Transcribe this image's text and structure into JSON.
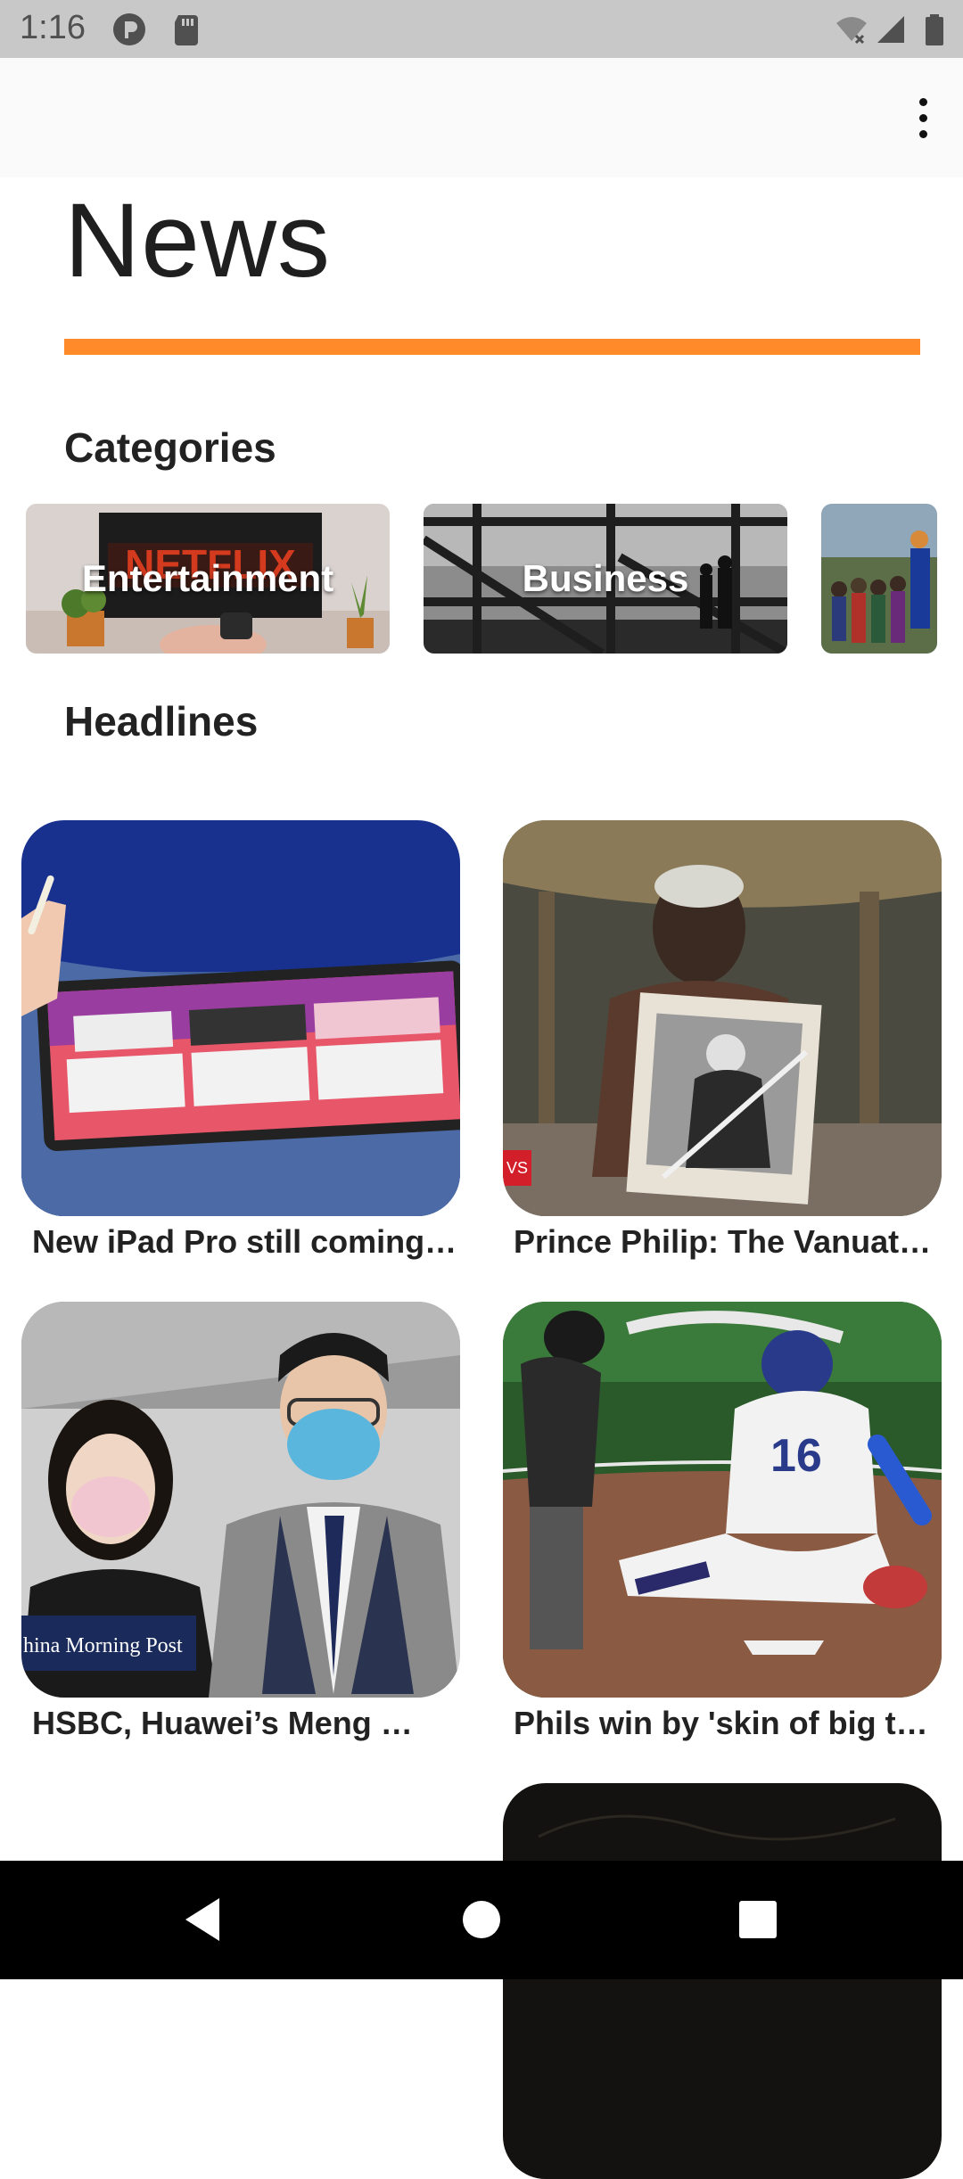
{
  "status_bar": {
    "time": "1:16",
    "icons_left": [
      "p-app-icon",
      "sd-card-icon"
    ],
    "icons_right": [
      "wifi-off-icon",
      "signal-icon",
      "battery-icon"
    ]
  },
  "app_bar": {
    "overflow_icon": "more-vert-icon"
  },
  "page": {
    "title": "News",
    "accent_color": "#ff8a2a",
    "categories_heading": "Categories",
    "headlines_heading": "Headlines"
  },
  "categories": [
    {
      "label": "Entertainment",
      "image": "tv-netflix-photo"
    },
    {
      "label": "Business",
      "image": "office-skyline-photo"
    },
    {
      "label": "",
      "image": "crowd-photo"
    }
  ],
  "headlines": [
    {
      "title": "New iPad Pro still coming …",
      "image": "ipad-photo"
    },
    {
      "title": "Prince Philip: The Vanuatu …",
      "image": "vanuatu-man-photo",
      "badge": "VS"
    },
    {
      "title": "HSBC, Huawei’s Meng …",
      "image": "meng-photo",
      "watermark": "hina Morning Post"
    },
    {
      "title": "Phils win by 'skin of big toe…",
      "image": "baseball-photo"
    },
    {
      "title": "",
      "image": "dark-photo"
    }
  ],
  "nav_bar": {
    "back": "back-triangle-icon",
    "home": "home-circle-icon",
    "recents": "recents-square-icon"
  }
}
